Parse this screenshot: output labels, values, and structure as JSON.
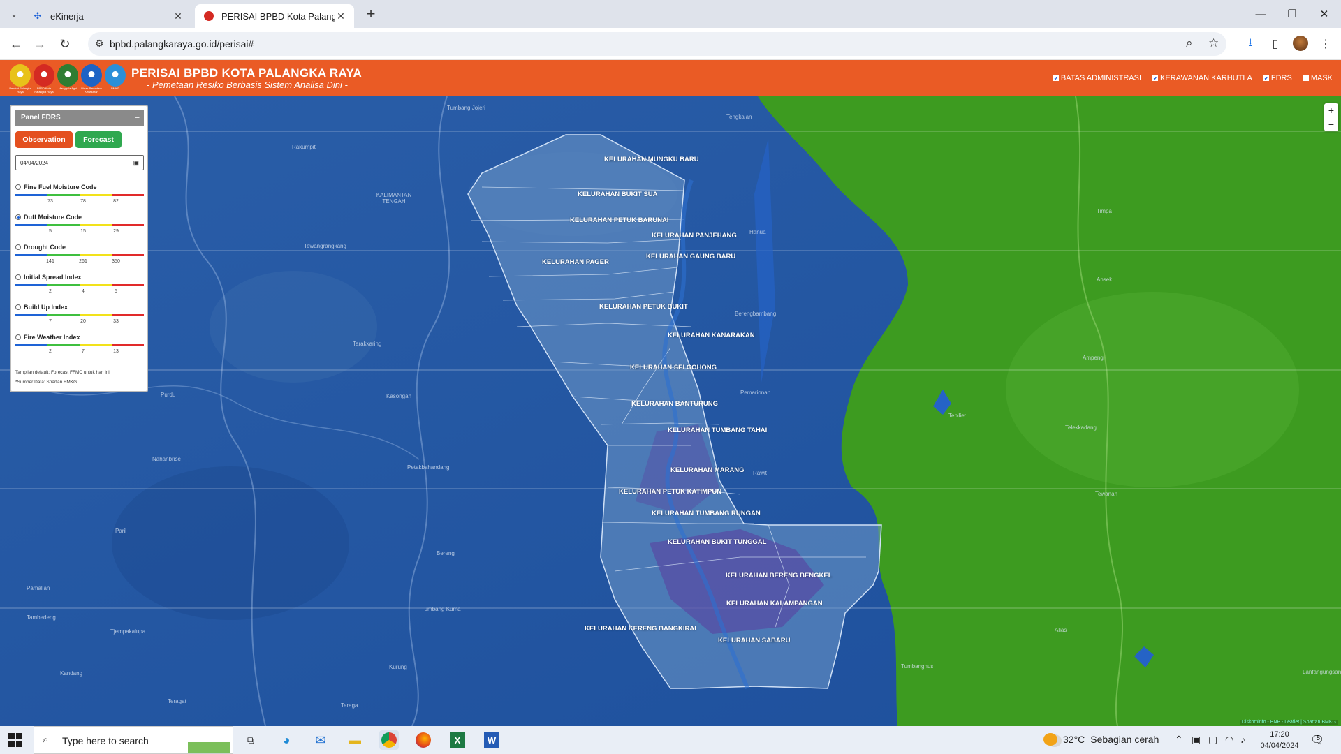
{
  "browser": {
    "tabs": [
      {
        "title": "eKinerja",
        "icon": "ekinerja-favicon"
      },
      {
        "title": "PERISAI BPBD Kota Palangka Ra",
        "icon": "bpbd-favicon",
        "active": true
      }
    ],
    "url": "bpbd.palangkaraya.go.id/perisai#"
  },
  "header": {
    "title": "PERISAI BPBD KOTA PALANGKA RAYA",
    "subtitle": "- Pemetaan Resiko Berbasis Sistem Analisa Dini -",
    "logos": [
      {
        "caption": "Pemkot Palangka Raya",
        "color": "#e8c21a"
      },
      {
        "caption": "BPBD Kota Palangka Raya",
        "color": "#d42a22"
      },
      {
        "caption": "Manggala Agni",
        "color": "#2f7d32"
      },
      {
        "caption": "Dinas Pemadam Kebakaran",
        "color": "#1e63c4"
      },
      {
        "caption": "BMKG",
        "color": "#2c8fd8"
      }
    ],
    "layers": [
      {
        "label": "BATAS ADMINISTRASI",
        "checked": true
      },
      {
        "label": "KERAWANAN KARHUTLA",
        "checked": true
      },
      {
        "label": "FDRS",
        "checked": true
      },
      {
        "label": "MASK",
        "checked": false
      }
    ]
  },
  "panel": {
    "title": "Panel FDRS",
    "observation_label": "Observation",
    "forecast_label": "Forecast",
    "date_value": "04/04/2024",
    "indices": [
      {
        "name": "Fine Fuel Moisture Code",
        "ticks": [
          "73",
          "78",
          "82"
        ],
        "selected": false
      },
      {
        "name": "Duff Moisture Code",
        "ticks": [
          "5",
          "15",
          "29"
        ],
        "selected": true
      },
      {
        "name": "Drought Code",
        "ticks": [
          "141",
          "261",
          "350"
        ],
        "selected": false
      },
      {
        "name": "Initial Spread Index",
        "ticks": [
          "2",
          "4",
          "5"
        ],
        "selected": false
      },
      {
        "name": "Build Up Index",
        "ticks": [
          "7",
          "20",
          "33"
        ],
        "selected": false
      },
      {
        "name": "Fire Weather Index",
        "ticks": [
          "2",
          "7",
          "13"
        ],
        "selected": false
      }
    ],
    "scale_colors": [
      "#1e63d6",
      "#3fbf3f",
      "#f2e21a",
      "#e12a2a"
    ],
    "note_default": "Tampilan default: Forecast FFMC untuk hari ini",
    "note_source": "*Sumber Data: Spartan BMKG"
  },
  "map": {
    "kelurahan": [
      "KELURAHAN MUNGKU BARU",
      "KELURAHAN BUKIT SUA",
      "KELURAHAN PETUK BARUNAI",
      "KELURAHAN PANJEHANG",
      "KELURAHAN GAUNG BARU",
      "KELURAHAN PAGER",
      "KELURAHAN PETUK BUKIT",
      "KELURAHAN KANARAKAN",
      "KELURAHAN SEI GOHONG",
      "KELURAHAN BANTURUNG",
      "KELURAHAN TUMBANG TAHAI",
      "KELURAHAN MARANG",
      "KELURAHAN PETUK KATIMPUN",
      "KELURAHAN TUMBANG RUNGAN",
      "KELURAHAN BUKIT TUNGGAL",
      "KELURAHAN BERENG BENGKEL",
      "KELURAHAN KALAMPANGAN",
      "KELURAHAN KERENG BANGKIRAI",
      "KELURAHAN SABARU"
    ],
    "places": [
      "Tumbang Jojeri",
      "Tengkalan",
      "Rakumpit",
      "KALIMANTAN TENGAH",
      "Tewangrangkang",
      "Hanua",
      "Timpa",
      "Ansek",
      "Berengbambang",
      "Tarakkaring",
      "Ampeng",
      "Purdu",
      "Kasongan",
      "Pemarionan",
      "Tebiliet",
      "Telekkadang",
      "Nahanbrise",
      "Petakbahandang",
      "Rawit",
      "Tewanan",
      "Paril",
      "Bereng",
      "Pamalian",
      "Tumbang Kuma",
      "Tjempakalupa",
      "Tambedeng",
      "Alias",
      "Kandang",
      "Kurung",
      "Teraga",
      "Teragat",
      "Tumbangnus",
      "Lanfangungsang"
    ],
    "attribution": "Diskominfo - BNP - Leaflet | Spartan BMKG",
    "zoom_in": "+",
    "zoom_out": "−",
    "legend_colors": {
      "low": "#1e63d6",
      "moderate": "#3fa31e"
    }
  },
  "taskbar": {
    "search_placeholder": "Type here to search",
    "weather_temp": "32°C",
    "weather_desc": "Sebagian cerah",
    "time": "17:20",
    "date": "04/04/2024",
    "notifications": "5",
    "apps": [
      "task-view",
      "edge",
      "mail",
      "file-explorer",
      "chrome",
      "firefox",
      "excel",
      "word"
    ]
  }
}
